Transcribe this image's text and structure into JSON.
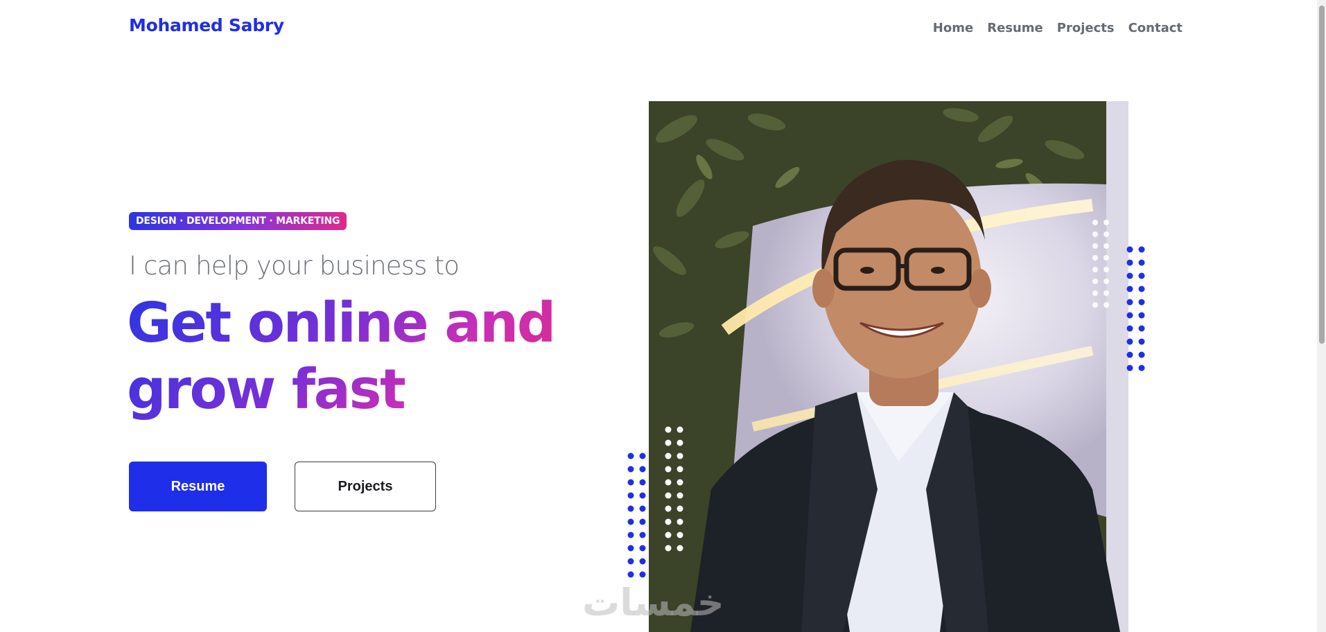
{
  "header": {
    "brand": "Mohamed Sabry",
    "nav": [
      "Home",
      "Resume",
      "Projects",
      "Contact"
    ]
  },
  "hero": {
    "tagline": "DESIGN · DEVELOPMENT · MARKETING",
    "subhead": "I can help your business to",
    "headline_line1": "Get online and",
    "headline_line2": "grow fast",
    "primary_button": "Resume",
    "secondary_button": "Projects"
  },
  "portrait": {
    "description_icon": "profile-photo"
  },
  "watermark": "خمسات",
  "colors": {
    "accent": "#1f2ee8",
    "gradient_start": "#2b35e4",
    "gradient_mid": "#8a34d8",
    "gradient_end": "#e52a7c",
    "nav_text": "#666a73"
  }
}
